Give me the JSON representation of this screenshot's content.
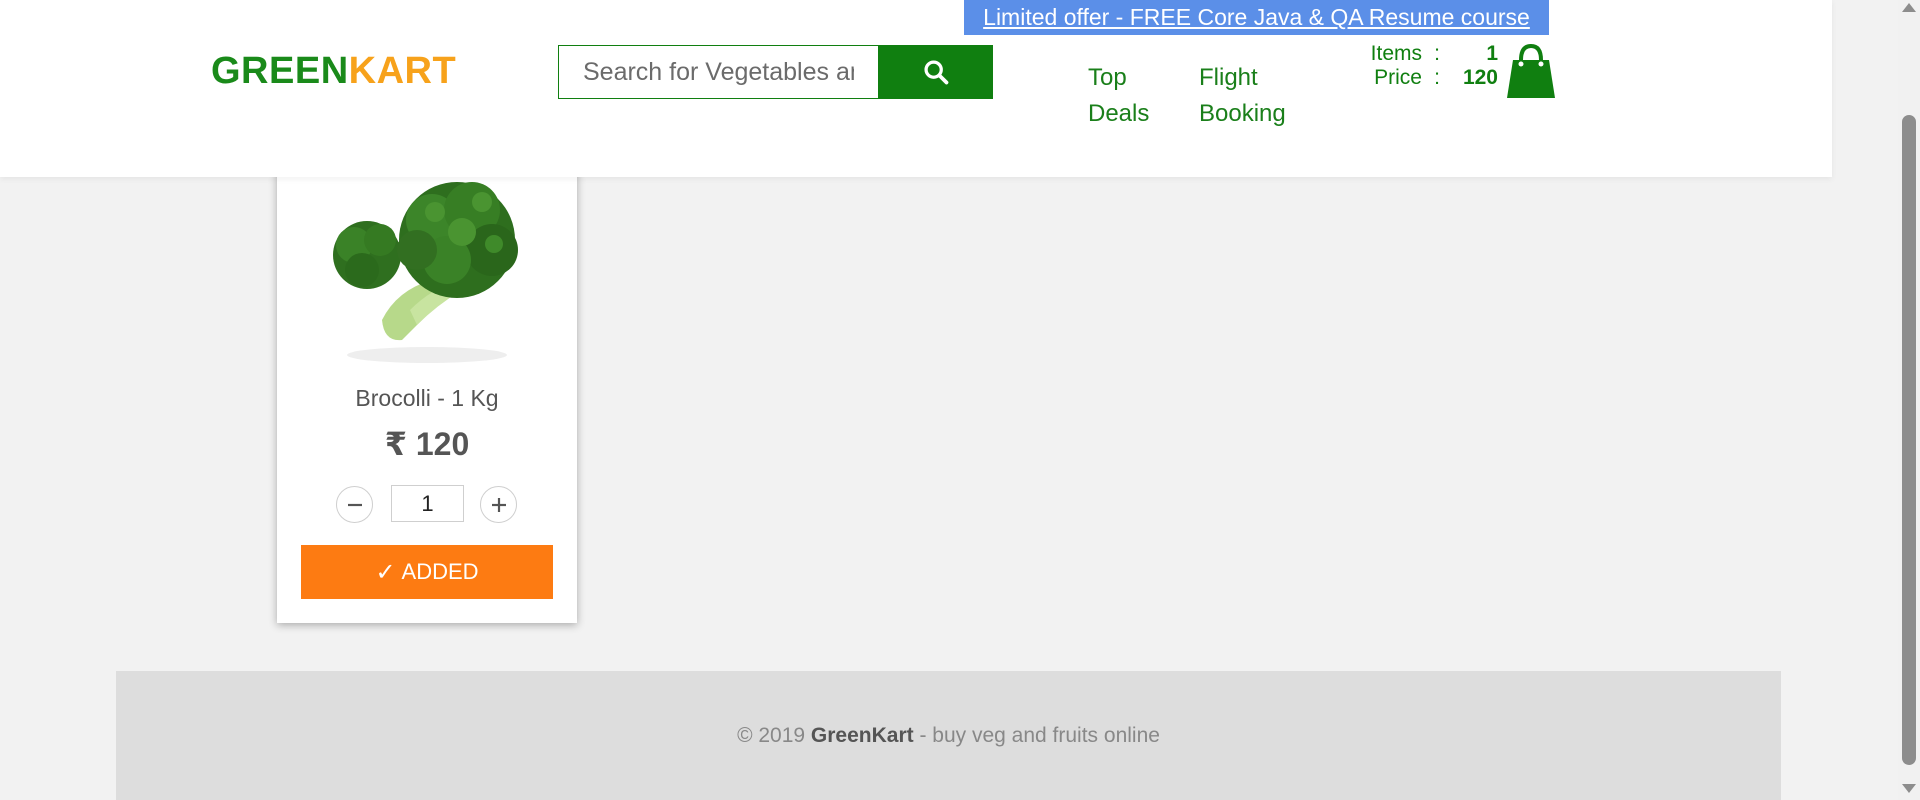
{
  "header": {
    "offer_link": "Limited offer - FREE Core Java & QA Resume course",
    "brand": {
      "part1": "GREEN",
      "part2": "KART"
    },
    "search": {
      "placeholder": "Search for Vegetables and Fruits",
      "icon": "search-icon"
    },
    "nav": [
      {
        "line1": "Top",
        "line2": "Deals"
      },
      {
        "line1": "Flight",
        "line2": "Booking"
      }
    ],
    "cart": {
      "items_label": "Items",
      "items_value": "1",
      "price_label": "Price",
      "price_value": "120",
      "separator": ":",
      "icon": "shopping-bag-icon"
    }
  },
  "product": {
    "name": "Brocolli - 1 Kg",
    "price": "₹ 120",
    "quantity": "1",
    "button_check": "✓",
    "button_label": "ADDED",
    "image_icon": "broccoli-image"
  },
  "footer": {
    "prefix": "© 2019 ",
    "brand": "GreenKart",
    "suffix": " - buy veg and fruits online"
  },
  "colors": {
    "brand_green": "#1a8a1a",
    "brand_orange": "#f7a21b",
    "offer_blue": "#5b8fe8",
    "added_orange": "#fd7b12",
    "search_green": "#107f10"
  }
}
